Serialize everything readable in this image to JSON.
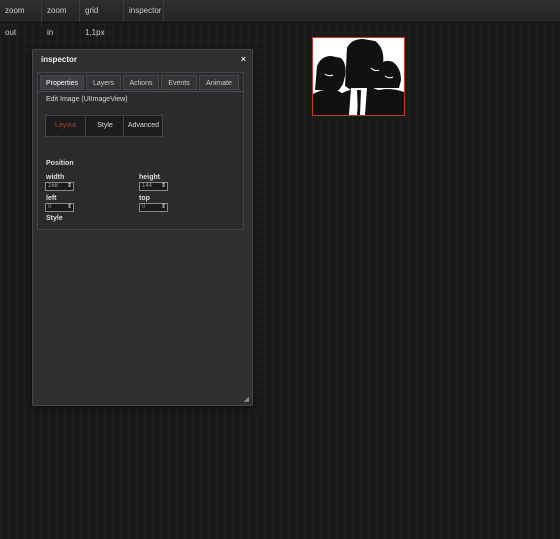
{
  "toolbar": {
    "buttons": [
      "zoom out",
      "zoom in",
      "grid 1,1px",
      "inspector"
    ]
  },
  "inspector": {
    "title": "inspector",
    "close_glyph": "×",
    "tabs": [
      "Properties",
      "Layers",
      "Actions",
      "Events",
      "Animate"
    ],
    "active_tab": "Properties",
    "edit_label": "Edit Image (UIImageView)",
    "subtabs": [
      "Layout",
      "Style",
      "Advanced"
    ],
    "active_subtab": "Layout",
    "position": {
      "section_label": "Position",
      "width_label": "width",
      "width_value": "168",
      "height_label": "height",
      "height_value": "144",
      "left_label": "left",
      "left_value": "0",
      "top_label": "top",
      "top_value": "0"
    },
    "style_label": "Style",
    "stepper_glyph": "⇕",
    "resize_glyph": "◢"
  },
  "canvas_image": {
    "description_icon": "silhouette-group-image"
  },
  "colors": {
    "accent_red": "#b53a22",
    "selection_border": "#c23a2a"
  }
}
